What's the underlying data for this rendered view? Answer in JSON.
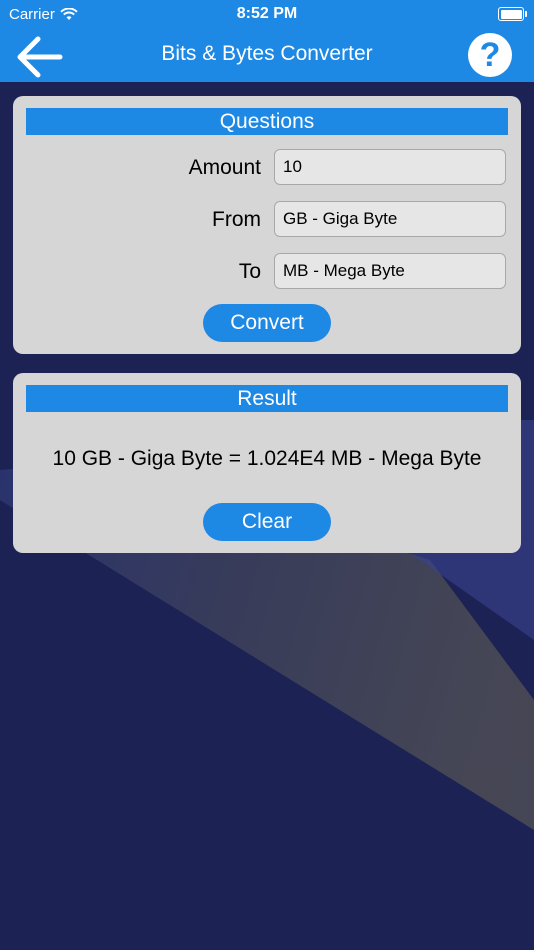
{
  "status": {
    "carrier": "Carrier",
    "time": "8:52 PM"
  },
  "nav": {
    "title": "Bits & Bytes Converter",
    "help_symbol": "?"
  },
  "questions": {
    "header": "Questions",
    "amount_label": "Amount",
    "amount_value": "10",
    "from_label": "From",
    "from_value": "GB - Giga Byte",
    "to_label": "To",
    "to_value": "MB - Mega Byte",
    "convert_label": "Convert"
  },
  "result": {
    "header": "Result",
    "text": "10 GB - Giga Byte = 1.024E4 MB - Mega Byte",
    "clear_label": "Clear"
  },
  "colors": {
    "accent": "#1e88e5",
    "card": "#d6d6d6",
    "background": "#1c2354"
  }
}
